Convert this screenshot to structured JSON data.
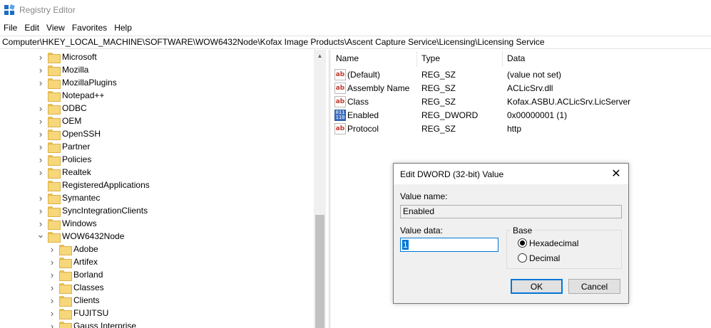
{
  "window": {
    "title": "Registry Editor"
  },
  "menu": [
    "File",
    "Edit",
    "View",
    "Favorites",
    "Help"
  ],
  "address": "Computer\\HKEY_LOCAL_MACHINE\\SOFTWARE\\WOW6432Node\\Kofax Image Products\\Ascent Capture Service\\Licensing\\Licensing Service",
  "tree": {
    "items": [
      {
        "label": "Microsoft",
        "expanded": false,
        "has_children": true
      },
      {
        "label": "Mozilla",
        "expanded": false,
        "has_children": true
      },
      {
        "label": "MozillaPlugins",
        "expanded": false,
        "has_children": true
      },
      {
        "label": "Notepad++",
        "expanded": false,
        "has_children": false
      },
      {
        "label": "ODBC",
        "expanded": false,
        "has_children": true
      },
      {
        "label": "OEM",
        "expanded": false,
        "has_children": true
      },
      {
        "label": "OpenSSH",
        "expanded": false,
        "has_children": true
      },
      {
        "label": "Partner",
        "expanded": false,
        "has_children": true
      },
      {
        "label": "Policies",
        "expanded": false,
        "has_children": true
      },
      {
        "label": "Realtek",
        "expanded": false,
        "has_children": true
      },
      {
        "label": "RegisteredApplications",
        "expanded": false,
        "has_children": false
      },
      {
        "label": "Symantec",
        "expanded": false,
        "has_children": true
      },
      {
        "label": "SyncIntegrationClients",
        "expanded": false,
        "has_children": true
      },
      {
        "label": "Windows",
        "expanded": false,
        "has_children": true
      },
      {
        "label": "WOW6432Node",
        "expanded": true,
        "has_children": true
      },
      {
        "label": "Adobe",
        "expanded": false,
        "has_children": true,
        "child": true
      },
      {
        "label": "Artifex",
        "expanded": false,
        "has_children": true,
        "child": true
      },
      {
        "label": "Borland",
        "expanded": false,
        "has_children": true,
        "child": true
      },
      {
        "label": "Classes",
        "expanded": false,
        "has_children": true,
        "child": true
      },
      {
        "label": "Clients",
        "expanded": false,
        "has_children": true,
        "child": true
      },
      {
        "label": "FUJITSU",
        "expanded": false,
        "has_children": true,
        "child": true
      },
      {
        "label": "Gauss Interprise",
        "expanded": false,
        "has_children": true,
        "child": true
      }
    ]
  },
  "values": {
    "columns": {
      "name": "Name",
      "type": "Type",
      "data": "Data"
    },
    "rows": [
      {
        "name": "(Default)",
        "type": "REG_SZ",
        "data": "(value not set)",
        "icon": "string-value-icon"
      },
      {
        "name": "Assembly Name",
        "type": "REG_SZ",
        "data": "ACLicSrv.dll",
        "icon": "string-value-icon"
      },
      {
        "name": "Class",
        "type": "REG_SZ",
        "data": "Kofax.ASBU.ACLicSrv.LicServer",
        "icon": "string-value-icon"
      },
      {
        "name": "Enabled",
        "type": "REG_DWORD",
        "data": "0x00000001 (1)",
        "icon": "binary-value-icon"
      },
      {
        "name": "Protocol",
        "type": "REG_SZ",
        "data": "http",
        "icon": "string-value-icon"
      }
    ]
  },
  "dialog": {
    "title": "Edit DWORD (32-bit) Value",
    "value_name_label": "Value name:",
    "value_name": "Enabled",
    "value_data_label": "Value data:",
    "value_data": "1",
    "base_label": "Base",
    "hex_label": "Hexadecimal",
    "dec_label": "Decimal",
    "selected_base": "Hexadecimal",
    "ok_label": "OK",
    "cancel_label": "Cancel",
    "close_glyph": "✕"
  },
  "colors": {
    "accent": "#0078d7",
    "folder": "#f6d77a"
  }
}
